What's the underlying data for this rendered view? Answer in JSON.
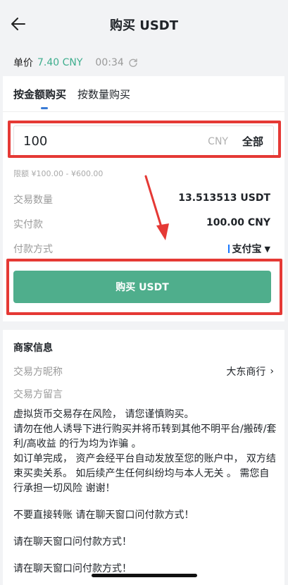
{
  "header": {
    "title": "购买 USDT"
  },
  "price_bar": {
    "unit_price_label": "单价",
    "unit_price_value": "7.40 CNY",
    "countdown": "00:34"
  },
  "tabs": [
    {
      "label": "按金额购买",
      "active": true
    },
    {
      "label": "按数量购买",
      "active": false
    }
  ],
  "order": {
    "amount_value": "100",
    "amount_currency": "CNY",
    "all_label": "全部",
    "limit_text": "限额 ¥100.00 - ¥600.00",
    "quantity_label": "交易数量",
    "quantity_value": "13.513513 USDT",
    "actual_pay_label": "实付款",
    "actual_pay_value": "100.00 CNY",
    "payment_label": "付款方式",
    "payment_value": "支付宝",
    "buy_button": "购买 USDT"
  },
  "merchant": {
    "title": "商家信息",
    "nickname_label": "交易方昵称",
    "nickname_value": "大东商行",
    "message_label": "交易方留言",
    "message_lines": [
      "虚拟货币交易存在风险， 请您谨慎购买。\n请勿在他人诱导下进行购买并将币转到其他不明平台/搬砖/套利/高收益 的行为均为诈骗 。\n 如订单完成， 资产会经平台自动发放至您的账户中， 双方结束买卖关系。 如后续产生任何纠纷均与本人无关 。 需您自行承担一切风险  谢谢！",
      "不要直接转账  请在聊天窗口问付款方式！",
      "请在聊天窗口问付款方式！",
      "请在聊天窗口问付款方式！"
    ]
  },
  "colors": {
    "accent_green": "#4fae8c",
    "price_green": "#3fae8e",
    "highlight_red": "#e53935",
    "tab_blue": "#3a7bd5"
  },
  "icons": {
    "back": "arrow-left-icon",
    "refresh": "refresh-icon",
    "dropdown": "caret-down-icon",
    "chevron": "chevron-right-icon"
  }
}
